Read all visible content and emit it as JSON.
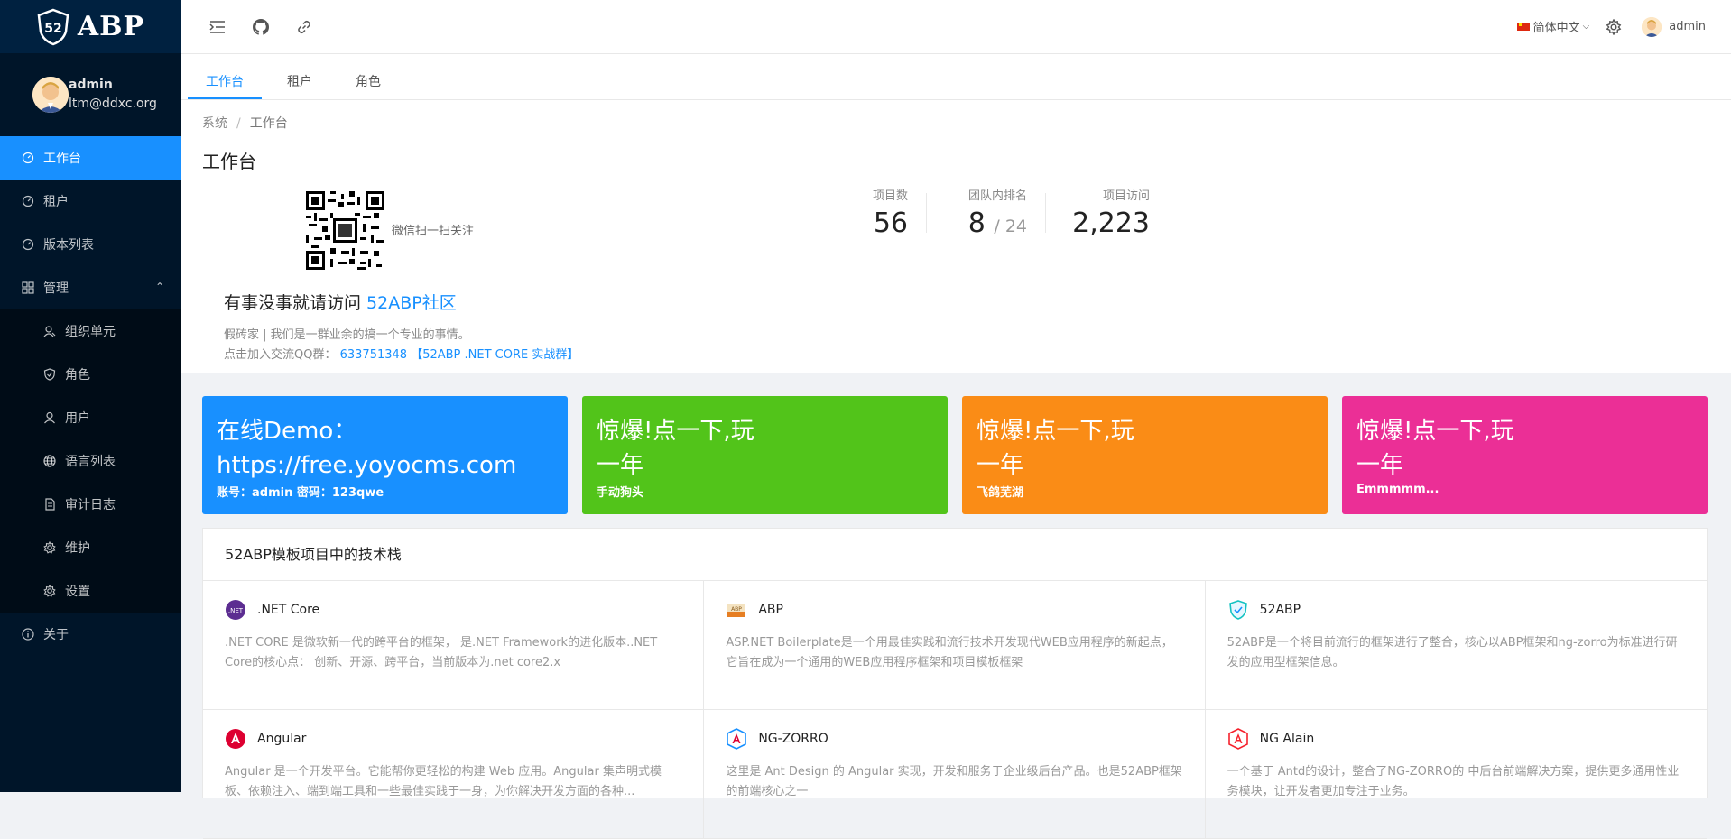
{
  "brand": {
    "logo_text": "ABP",
    "shield_text": "52"
  },
  "user": {
    "name": "admin",
    "email": "ltm@ddxc.org"
  },
  "sidebar": {
    "items": [
      {
        "label": "工作台",
        "icon": "dashboard-icon",
        "active": true
      },
      {
        "label": "租户",
        "icon": "dashboard-icon"
      },
      {
        "label": "版本列表",
        "icon": "dashboard-icon"
      },
      {
        "label": "管理",
        "icon": "appstore-icon",
        "expanded": true
      }
    ],
    "sub_items": [
      {
        "label": "组织单元",
        "icon": "team-icon"
      },
      {
        "label": "角色",
        "icon": "safety-icon"
      },
      {
        "label": "用户",
        "icon": "user-icon"
      },
      {
        "label": "语言列表",
        "icon": "global-icon"
      },
      {
        "label": "审计日志",
        "icon": "file-icon"
      },
      {
        "label": "维护",
        "icon": "setting-icon"
      },
      {
        "label": "设置",
        "icon": "setting-icon"
      }
    ],
    "about": {
      "label": "关于",
      "icon": "info-icon"
    }
  },
  "header": {
    "language": "简体中文",
    "username": "admin"
  },
  "tabs": [
    {
      "label": "工作台",
      "active": true
    },
    {
      "label": "租户"
    },
    {
      "label": "角色"
    }
  ],
  "breadcrumb": {
    "root": "系统",
    "separator": "/",
    "current": "工作台"
  },
  "page_title": "工作台",
  "qr_caption": "微信扫一扫关注",
  "stats": [
    {
      "label": "项目数",
      "value": "56"
    },
    {
      "label": "团队内排名",
      "value": "8",
      "suffix": "/ 24"
    },
    {
      "label": "项目访问",
      "value": "2,223"
    }
  ],
  "welcome": {
    "text": "有事没事就请访问 ",
    "link": "52ABP社区"
  },
  "desc": {
    "line1": "假砖家 | 我们是一群业余的搞一个专业的事情。",
    "line2_prefix": "点击加入交流QQ群：",
    "qq": "633751348",
    "group": "【52ABP .NET CORE 实战群】"
  },
  "cards": [
    {
      "line1": "在线Demo：",
      "line2": "https://free.yoyocms.com",
      "sub": "账号：admin 密码：123qwe",
      "color": "#1890ff"
    },
    {
      "line1": "惊爆!点一下,玩",
      "line2": "一年",
      "sub": "手动狗头",
      "color": "#52c41a"
    },
    {
      "line1": "惊爆!点一下,玩",
      "line2": "一年",
      "sub": "飞鸽芜湖",
      "color": "#fa8c16"
    },
    {
      "line1": "惊爆!点一下,玩",
      "line2": "一年",
      "sub": "Emmmmm...",
      "color": "#eb2f96"
    }
  ],
  "tech": {
    "title": "52ABP模板项目中的技术栈",
    "items": [
      {
        "name": ".NET Core",
        "icon": "dotnet-icon",
        "desc": ".NET CORE 是微软新一代的跨平台的框架， 是.NET Framework的进化版本..NET Core的核心点： 创新、开源、跨平台，当前版本为.net core2.x"
      },
      {
        "name": "ABP",
        "icon": "abp-icon",
        "desc": "ASP.NET Boilerplate是一个用最佳实践和流行技术开发现代WEB应用程序的新起点，它旨在成为一个通用的WEB应用程序框架和项目模板框架"
      },
      {
        "name": "52ABP",
        "icon": "shield-icon",
        "desc": "52ABP是一个将目前流行的框架进行了整合，核心以ABP框架和ng-zorro为标准进行研发的应用型框架信息。"
      },
      {
        "name": "Angular",
        "icon": "angular-icon",
        "desc": "Angular 是一个开发平台。它能帮你更轻松的构建 Web 应用。Angular 集声明式模板、依赖注入、端到端工具和一些最佳实践于一身，为你解决开发方面的各种..."
      },
      {
        "name": "NG-ZORRO",
        "icon": "ng-zorro-icon",
        "desc": "这里是 Ant Design 的 Angular 实现，开发和服务于企业级后台产品。也是52ABP框架的前端核心之一"
      },
      {
        "name": "NG Alain",
        "icon": "ng-alain-icon",
        "desc": "一个基于 Antd的设计，整合了NG-ZORRO的 中后台前端解决方案，提供更多通用性业务模块，让开发者更加专注于业务。"
      }
    ]
  }
}
